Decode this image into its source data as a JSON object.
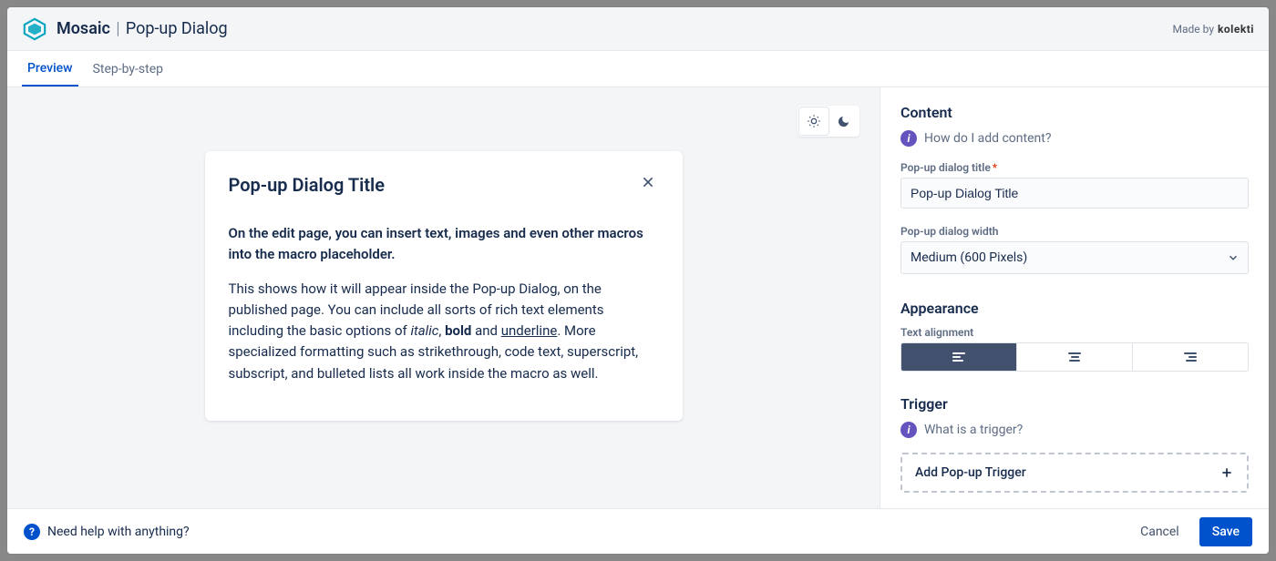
{
  "header": {
    "brand": "Mosaic",
    "page": "Pop-up Dialog",
    "made_by_label": "Made by",
    "made_by_brand": "kolekti"
  },
  "tabs": {
    "preview": "Preview",
    "step_by_step": "Step-by-step"
  },
  "dialog_preview": {
    "title": "Pop-up Dialog Title",
    "lead": "On the edit page, you can insert text, images and even other macros into the macro placeholder.",
    "body1": "This shows how it will appear inside the Pop-up Dialog, on the published page. You can include all sorts of rich text elements including the basic options of ",
    "italic_word": "italic",
    "comma1": ", ",
    "bold_word": "bold",
    "and_word": " and ",
    "underline_word": "underline",
    "body2": ". More specialized formatting such as strikethrough, code text, superscript, subscript, and bulleted lists all work inside the macro as well."
  },
  "config": {
    "content_heading": "Content",
    "help_content": "How do I add content?",
    "title_label": "Pop-up dialog title",
    "title_value": "Pop-up Dialog Title",
    "width_label": "Pop-up dialog width",
    "width_value": "Medium (600 Pixels)",
    "appearance_heading": "Appearance",
    "align_label": "Text alignment",
    "trigger_heading": "Trigger",
    "help_trigger": "What is a trigger?",
    "add_trigger": "Add Pop-up Trigger"
  },
  "footer": {
    "help": "Need help with anything?",
    "cancel": "Cancel",
    "save": "Save"
  }
}
